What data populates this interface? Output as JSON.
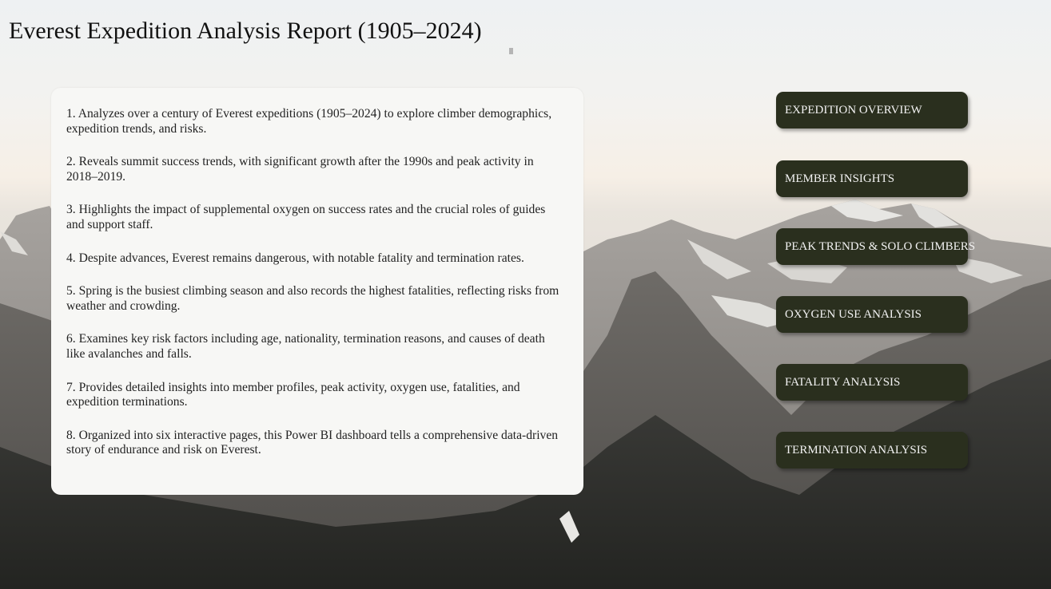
{
  "report": {
    "title": "Everest Expedition Analysis Report (1905–2024)"
  },
  "summary": {
    "items": [
      "1.  Analyzes over a century of Everest expeditions (1905–2024) to explore climber demographics, expedition trends, and risks.",
      "2.  Reveals summit success trends, with significant growth after the 1990s and peak activity in 2018–2019.",
      "3.  Highlights the impact of supplemental oxygen on success rates and the crucial roles of guides and support staff.",
      "4.  Despite advances, Everest remains dangerous, with notable fatality and termination rates.",
      "5.  Spring is the busiest climbing season and also records the highest fatalities, reflecting risks from weather and crowding.",
      "6.  Examines key risk factors including age, nationality, termination reasons, and causes of death like avalanches and falls.",
      "7.  Provides detailed insights into member profiles, peak activity, oxygen use, fatalities, and expedition terminations.",
      "8.  Organized into six interactive pages, this Power BI dashboard tells a comprehensive data-driven story of endurance and risk on Everest."
    ]
  },
  "navigation": {
    "buttons": [
      "EXPEDITION OVERVIEW",
      "MEMBER INSIGHTS",
      "PEAK TRENDS & SOLO CLIMBERS",
      "OXYGEN USE ANALYSIS",
      "FATALITY ANALYSIS",
      "TERMINATION ANALYSIS"
    ]
  },
  "colors": {
    "button_bg": "#2a2f1e",
    "button_text": "#f2f2f2",
    "card_bg": "#f7f7f5",
    "title_text": "#111111"
  }
}
